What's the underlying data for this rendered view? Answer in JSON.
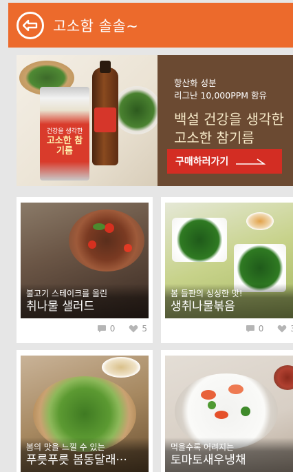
{
  "header": {
    "title": "고소함 솔솔~",
    "back_icon": "back-arrow-circle-icon"
  },
  "banner": {
    "subtitle_lines": [
      "항산화 성분",
      "리그난 10,000PPM 함유"
    ],
    "title_lines": [
      "백설 건강을 생각한",
      "고소한 참기름"
    ],
    "product_label_top": "건강을 생각한",
    "product_label_main": "고소한 참기름",
    "button_label": "구매하러가기"
  },
  "recipes": [
    {
      "subtitle": "불고기 스테이크를 올린",
      "title": "취나물 샐러드",
      "comments": "0",
      "likes": "5"
    },
    {
      "subtitle": "봄 들판의 싱싱한 맛!",
      "title": "생취나물볶음",
      "comments": "0",
      "likes": "3"
    },
    {
      "subtitle": "봄의 맛을 느낄 수 있는",
      "title": "푸릇푸릇 봄동달래···"
    },
    {
      "subtitle": "먹을수록 어려지는",
      "title": "토마토새우냉채"
    }
  ],
  "colors": {
    "header": "#ec6a2c",
    "banner_panel": "#6b4a32",
    "buy_button": "#d32d23"
  },
  "icons": {
    "comment": "speech-bubble-icon",
    "like": "heart-icon"
  }
}
